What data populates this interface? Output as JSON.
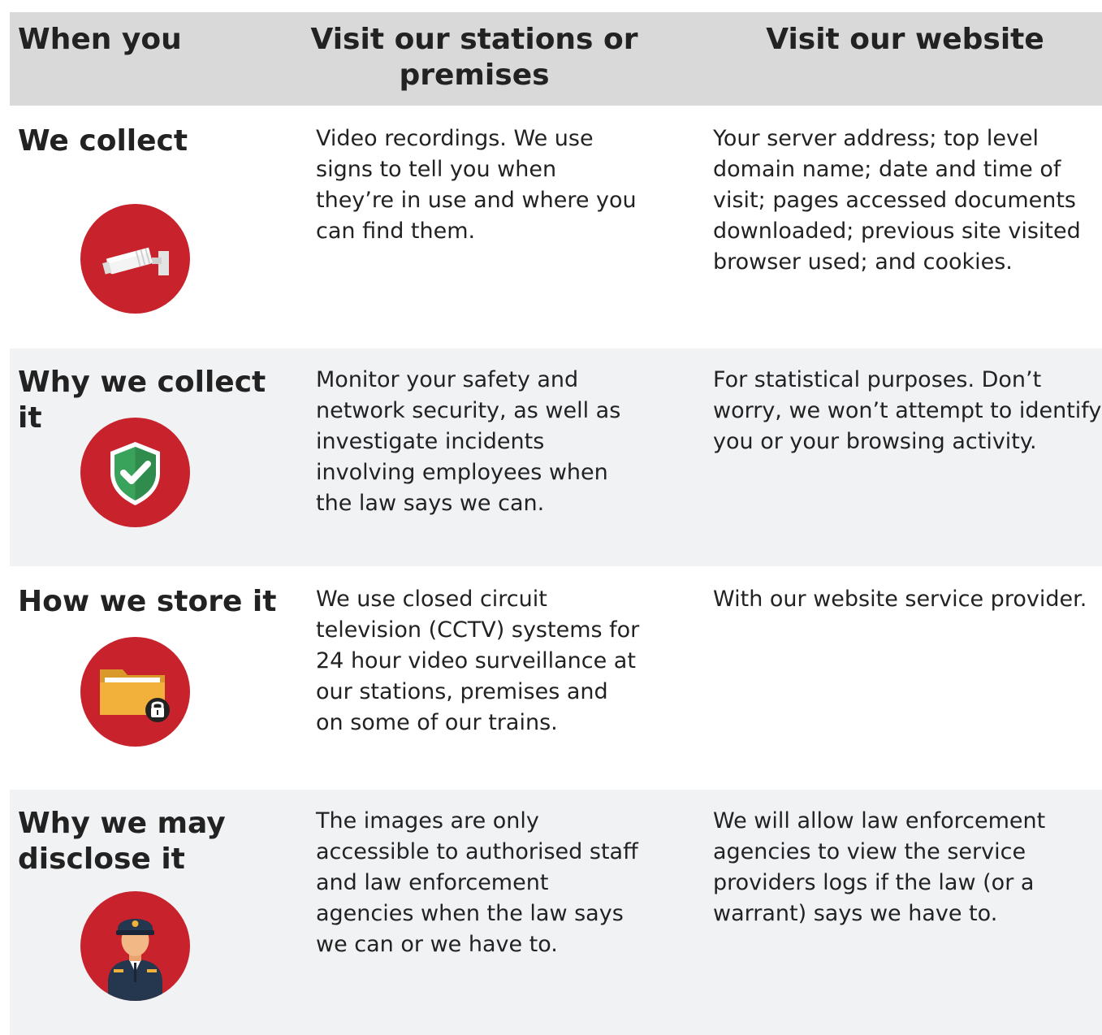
{
  "header": {
    "col1": "When you",
    "col2": "Visit our stations or premises",
    "col3": "Visit our website"
  },
  "rows": [
    {
      "title": "We collect",
      "icon": "cctv-camera-icon",
      "stations": "Video recordings. We use signs to tell you when they’re in use and where you can find them.",
      "website": "Your server address; top level domain name; date and time of visit; pages accessed documents downloaded; previous site visited browser used; and cookies."
    },
    {
      "title": "Why we collect it",
      "icon": "shield-check-icon",
      "stations": "Monitor your safety and network security, as well as investigate incidents involving employees when the law says we can.",
      "website": "For statistical purposes. Don’t worry, we won’t attempt to identify you or your browsing activity."
    },
    {
      "title": "How we store it",
      "icon": "locked-folder-icon",
      "stations": "We use closed circuit television (CCTV) systems for 24 hour video surveillance at our stations, premises and on some of our trains.",
      "website": "With our website service provider."
    },
    {
      "title": "Why we may disclose it",
      "icon": "police-officer-icon",
      "stations": "The images are only accessible to authorised staff and law enforcement agencies when the law says we can or we have to.",
      "website": "We will allow law enforcement agencies to view the service providers logs if the law (or a warrant) says we have to."
    }
  ],
  "colors": {
    "header_bg": "#d9d9d9",
    "row_alt_bg": "#f1f2f4",
    "icon_circle": "#c8232c",
    "text": "#222222"
  }
}
